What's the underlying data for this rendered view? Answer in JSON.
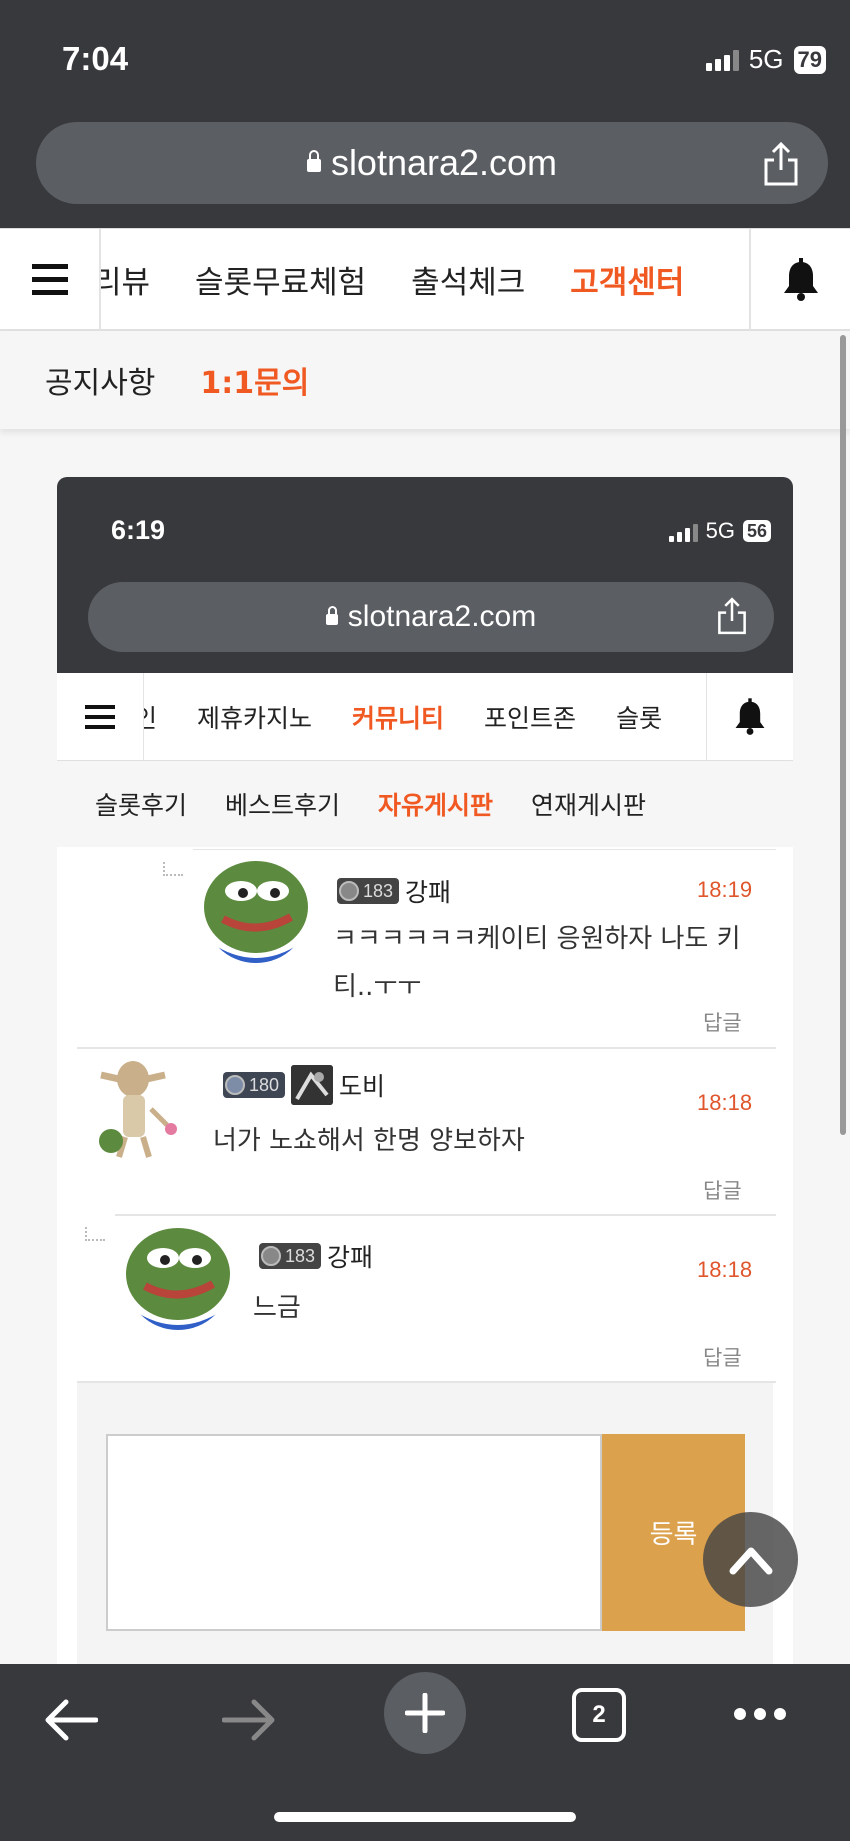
{
  "status_bar": {
    "time": "7:04",
    "network": "5G",
    "battery": "79"
  },
  "browser": {
    "url": "slotnara2.com",
    "tab_count": "2"
  },
  "nav": {
    "items": [
      {
        "label": "리뷰",
        "active": false
      },
      {
        "label": "슬롯무료체험",
        "active": false
      },
      {
        "label": "출석체크",
        "active": false
      },
      {
        "label": "고객센터",
        "active": true
      }
    ]
  },
  "subnav": {
    "items": [
      {
        "label": "공지사항",
        "active": false
      },
      {
        "label": "1:1문의",
        "active": true
      }
    ]
  },
  "screenshot": {
    "status_bar": {
      "time": "6:19",
      "network": "5G",
      "battery": "56"
    },
    "url": "slotnara2.com",
    "nav": {
      "items": [
        {
          "label": "인",
          "active": false
        },
        {
          "label": "제휴카지노",
          "active": false
        },
        {
          "label": "커뮤니티",
          "active": true
        },
        {
          "label": "포인트존",
          "active": false
        },
        {
          "label": "슬롯",
          "active": false
        }
      ]
    },
    "subnav": {
      "items": [
        {
          "label": "슬롯후기",
          "active": false
        },
        {
          "label": "베스트후기",
          "active": false
        },
        {
          "label": "자유게시판",
          "active": true
        },
        {
          "label": "연재게시판",
          "active": false
        }
      ]
    },
    "comments": [
      {
        "level": "183",
        "author": "강패",
        "time": "18:19",
        "text": "ㅋㅋㅋㅋㅋㅋ케이티 응원하자 나도 키티..ㅜㅜ",
        "reply_label": "답글",
        "is_reply": true
      },
      {
        "level": "180",
        "author": "도비",
        "time": "18:18",
        "text": "너가 노쇼해서 한명 양보하자",
        "reply_label": "답글",
        "is_reply": false
      },
      {
        "level": "183",
        "author": "강패",
        "time": "18:18",
        "text": "느금",
        "reply_label": "답글",
        "is_reply": true
      }
    ],
    "submit_label": "등록"
  }
}
